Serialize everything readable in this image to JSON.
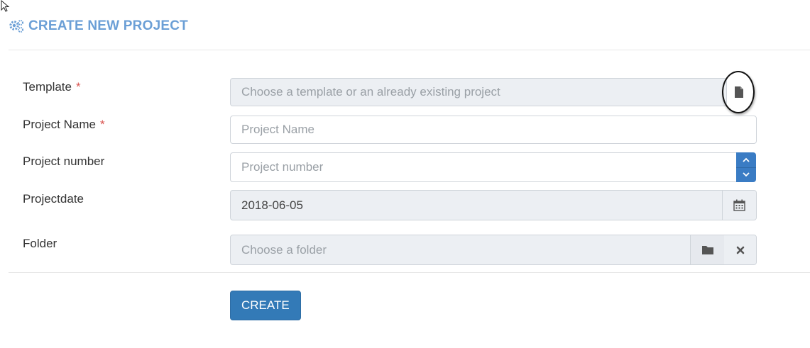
{
  "header": {
    "title": "CREATE NEW PROJECT",
    "icon": "gears-icon"
  },
  "form": {
    "template": {
      "label": "Template",
      "required_mark": "*",
      "placeholder": "Choose a template or an already existing project",
      "icon": "file-icon"
    },
    "project_name": {
      "label": "Project Name",
      "required_mark": "*",
      "placeholder": "Project Name"
    },
    "project_number": {
      "label": "Project number",
      "placeholder": "Project number",
      "icons": [
        "chevron-up-icon",
        "chevron-down-icon"
      ]
    },
    "project_date": {
      "label": "Projectdate",
      "value": "2018-06-05",
      "icon": "calendar-icon"
    },
    "folder": {
      "label": "Folder",
      "placeholder": "Choose a folder",
      "icons": [
        "folder-icon",
        "close-icon"
      ]
    }
  },
  "actions": {
    "create_label": "CREATE"
  },
  "colors": {
    "accent": "#6b9fd6",
    "primary_button": "#337ab7",
    "required": "#d9534f",
    "readonly_bg": "#eceff3"
  }
}
